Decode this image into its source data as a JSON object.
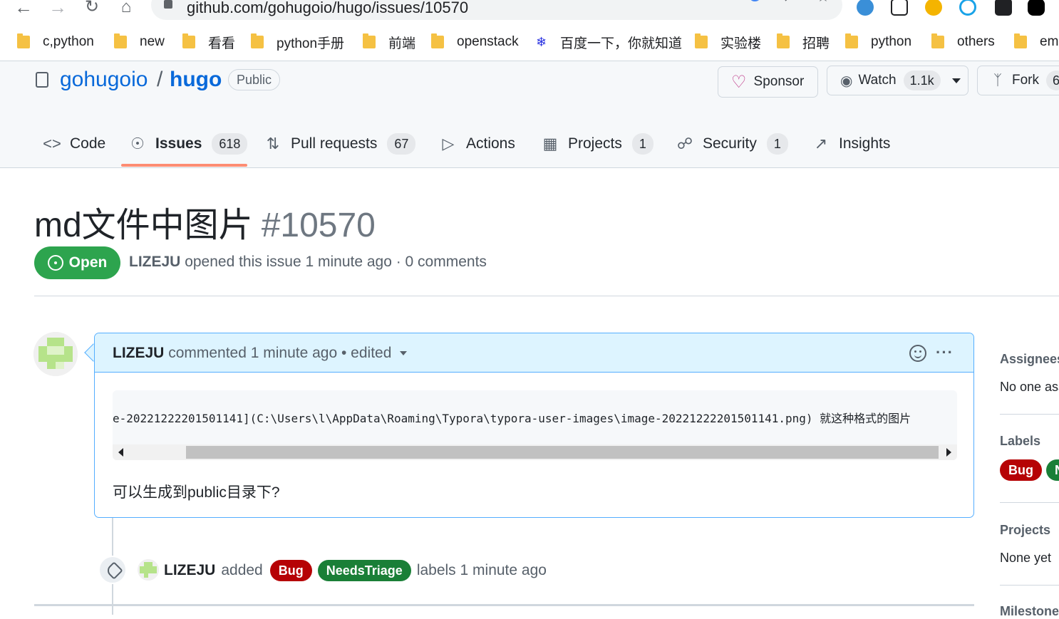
{
  "browser": {
    "url": "github.com/gohugoio/hugo/issues/10570",
    "bookmarks": [
      {
        "label": "c,python",
        "icon": "folder-icon"
      },
      {
        "label": "new",
        "icon": "folder-icon"
      },
      {
        "label": "看看",
        "icon": "folder-icon"
      },
      {
        "label": "python手册",
        "icon": "folder-icon"
      },
      {
        "label": "前端",
        "icon": "folder-icon"
      },
      {
        "label": "openstack",
        "icon": "folder-icon"
      },
      {
        "label": "百度一下，你就知道",
        "icon": "baidu-icon"
      },
      {
        "label": "实验楼",
        "icon": "folder-icon"
      },
      {
        "label": "招聘",
        "icon": "folder-icon"
      },
      {
        "label": "python",
        "icon": "folder-icon"
      },
      {
        "label": "others",
        "icon": "folder-icon"
      },
      {
        "label": "ema",
        "icon": "folder-icon"
      }
    ]
  },
  "repo": {
    "owner": "gohugoio",
    "separator": "/",
    "name": "hugo",
    "visibility": "Public",
    "sponsor_label": "Sponsor",
    "watch_label": "Watch",
    "watch_count": "1.1k",
    "fork_label": "Fork",
    "fork_count": "6"
  },
  "tabs": [
    {
      "label": "Code",
      "icon": "code-icon",
      "count": null
    },
    {
      "label": "Issues",
      "icon": "issue-opened-icon",
      "count": "618",
      "selected": true
    },
    {
      "label": "Pull requests",
      "icon": "git-pull-request-icon",
      "count": "67"
    },
    {
      "label": "Actions",
      "icon": "play-icon",
      "count": null
    },
    {
      "label": "Projects",
      "icon": "table-icon",
      "count": "1"
    },
    {
      "label": "Security",
      "icon": "shield-icon",
      "count": "1"
    },
    {
      "label": "Insights",
      "icon": "graph-icon",
      "count": null
    }
  ],
  "issue": {
    "title": "md文件中图片",
    "number": "#10570",
    "state": "Open",
    "author": "LIZEJU",
    "meta_rest": "opened this issue 1 minute ago · 0 comments"
  },
  "comment": {
    "author": "LIZEJU",
    "action": "commented 1 minute ago",
    "edited": "• edited",
    "code_line": "e-20221222201501141](C:\\Users\\l\\AppData\\Roaming\\Typora\\typora-user-images\\image-20221222201501141.png) 就这种格式的图片",
    "body": "可以生成到public目录下?"
  },
  "event": {
    "author": "LIZEJU",
    "action": "added",
    "labels": [
      {
        "name": "Bug",
        "color": "#b60205"
      },
      {
        "name": "NeedsTriage",
        "color": "#1a7f37"
      }
    ],
    "suffix": "labels 1 minute ago"
  },
  "sidebar": {
    "assignees_title": "Assignees",
    "assignees_value": "No one ass",
    "labels_title": "Labels",
    "label_chips": [
      {
        "name": "Bug",
        "color": "#b60205"
      },
      {
        "name": "N",
        "color": "#1a7f37"
      }
    ],
    "projects_title": "Projects",
    "projects_value": "None yet",
    "milestone_title": "Milestone"
  },
  "colors": {
    "accent": "#0969da",
    "open_green": "#2da44e",
    "tab_underline": "#fd8c73"
  }
}
